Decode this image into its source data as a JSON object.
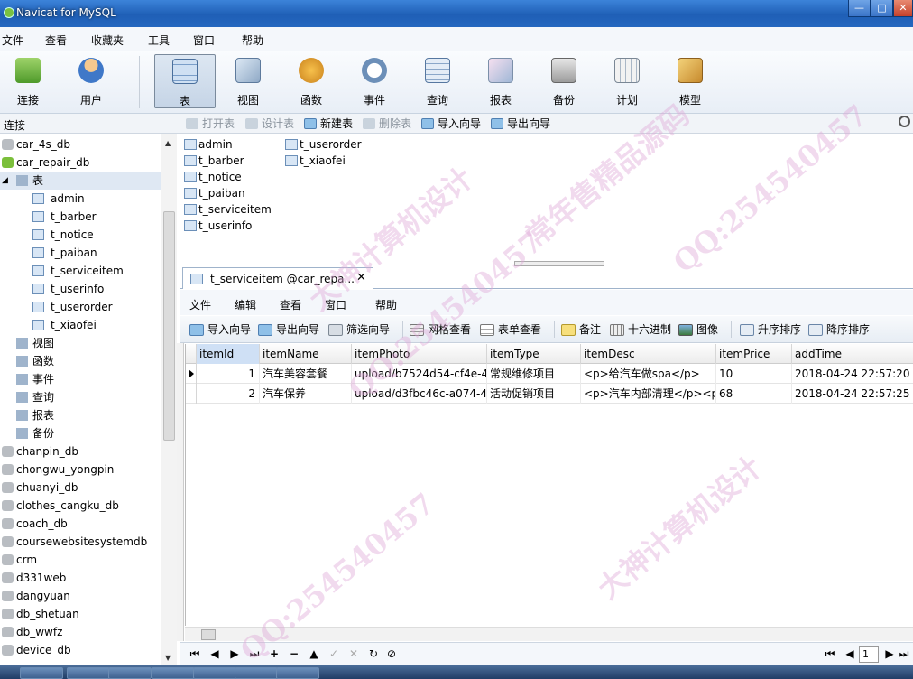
{
  "window": {
    "title": "Navicat for MySQL",
    "min": "—",
    "max": "□",
    "close": "✕"
  },
  "menu": [
    "文件",
    "查看",
    "收藏夹",
    "工具",
    "窗口",
    "帮助"
  ],
  "toolbar": [
    "连接",
    "用户",
    "表",
    "视图",
    "函数",
    "事件",
    "查询",
    "报表",
    "备份",
    "计划",
    "模型"
  ],
  "left_header": "连接",
  "actions": [
    "打开表",
    "设计表",
    "新建表",
    "删除表",
    "导入向导",
    "导出向导"
  ],
  "tree": {
    "dbs_top": [
      "car_4s_db",
      "car_repair_db"
    ],
    "tables_group": "表",
    "tables": [
      "admin",
      "t_barber",
      "t_notice",
      "t_paiban",
      "t_serviceitem",
      "t_userinfo",
      "t_userorder",
      "t_xiaofei"
    ],
    "groups": [
      "视图",
      "函数",
      "事件",
      "查询",
      "报表",
      "备份"
    ],
    "dbs_bottom": [
      "chanpin_db",
      "chongwu_yongpin",
      "chuanyi_db",
      "clothes_cangku_db",
      "coach_db",
      "coursewebsitesystemdb",
      "crm",
      "d331web",
      "dangyuan",
      "db_shetuan",
      "db_wwfz",
      "device_db"
    ]
  },
  "objects": [
    "admin",
    "t_barber",
    "t_notice",
    "t_paiban",
    "t_serviceitem",
    "t_userinfo",
    "t_userorder",
    "t_xiaofei"
  ],
  "tab": {
    "title": "t_serviceitem @car_repa...",
    "close": "✕"
  },
  "inner_menu": [
    "文件",
    "编辑",
    "查看",
    "窗口",
    "帮助"
  ],
  "inner_tools": [
    "导入向导",
    "导出向导",
    "筛选向导",
    "网格查看",
    "表单查看",
    "备注",
    "十六进制",
    "图像",
    "升序排序",
    "降序排序"
  ],
  "grid": {
    "columns": [
      "itemId",
      "itemName",
      "itemPhoto",
      "itemType",
      "itemDesc",
      "itemPrice",
      "addTime"
    ],
    "rows": [
      [
        "1",
        "汽车美容套餐",
        "upload/b7524d54-cf4e-4",
        "常规维修项目",
        "<p>给汽车做spa</p>",
        "10",
        "2018-04-24 22:57:20"
      ],
      [
        "2",
        "汽车保养",
        "upload/d3fbc46c-a074-4",
        "活动促销项目",
        "<p>汽车内部清理</p><p",
        "68",
        "2018-04-24 22:57:25"
      ]
    ]
  },
  "nav": {
    "first": "⏮",
    "prev": "◀",
    "next": "▶",
    "last": "⏭",
    "add": "+",
    "del": "−",
    "up": "▲",
    "check": "✓",
    "cancel": "✕",
    "refresh": "↻",
    "stop": "⊘",
    "page": "1",
    "pfirst": "⏮",
    "pprev": "◀",
    "pnext": "▶",
    "plast": "⏭"
  },
  "watermarks": [
    "大神计算机设计",
    "QQ:254540457",
    "常年售精品源码"
  ]
}
